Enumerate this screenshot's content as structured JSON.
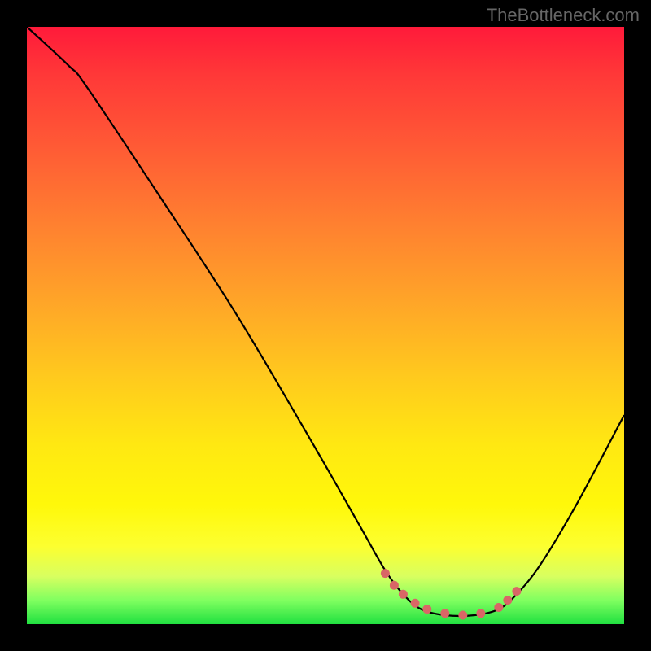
{
  "watermark": "TheBottleneck.com",
  "chart_data": {
    "type": "line",
    "title": "",
    "xlabel": "",
    "ylabel": "",
    "xlim": [
      0,
      100
    ],
    "ylim": [
      0,
      100
    ],
    "series": [
      {
        "name": "bottleneck-curve",
        "points": [
          {
            "x": 0,
            "y": 100
          },
          {
            "x": 7,
            "y": 93.5
          },
          {
            "x": 10,
            "y": 90
          },
          {
            "x": 22,
            "y": 72
          },
          {
            "x": 35,
            "y": 52
          },
          {
            "x": 48,
            "y": 30
          },
          {
            "x": 56,
            "y": 16
          },
          {
            "x": 60,
            "y": 9
          },
          {
            "x": 63,
            "y": 5
          },
          {
            "x": 66,
            "y": 2.5
          },
          {
            "x": 70,
            "y": 1.5
          },
          {
            "x": 75,
            "y": 1.5
          },
          {
            "x": 79,
            "y": 2.5
          },
          {
            "x": 82,
            "y": 5
          },
          {
            "x": 86,
            "y": 10
          },
          {
            "x": 92,
            "y": 20
          },
          {
            "x": 100,
            "y": 35
          }
        ]
      },
      {
        "name": "highlight-dots",
        "points": [
          {
            "x": 60,
            "y": 8.5
          },
          {
            "x": 61.5,
            "y": 6.5
          },
          {
            "x": 63,
            "y": 5
          },
          {
            "x": 65,
            "y": 3.5
          },
          {
            "x": 67,
            "y": 2.5
          },
          {
            "x": 70,
            "y": 1.8
          },
          {
            "x": 73,
            "y": 1.5
          },
          {
            "x": 76,
            "y": 1.8
          },
          {
            "x": 79,
            "y": 2.8
          },
          {
            "x": 80.5,
            "y": 4
          },
          {
            "x": 82,
            "y": 5.5
          }
        ]
      }
    ],
    "colors": {
      "curve": "#000000",
      "dots": "#d96666",
      "gradient_top": "#ff1a3a",
      "gradient_bottom": "#20e040"
    }
  }
}
